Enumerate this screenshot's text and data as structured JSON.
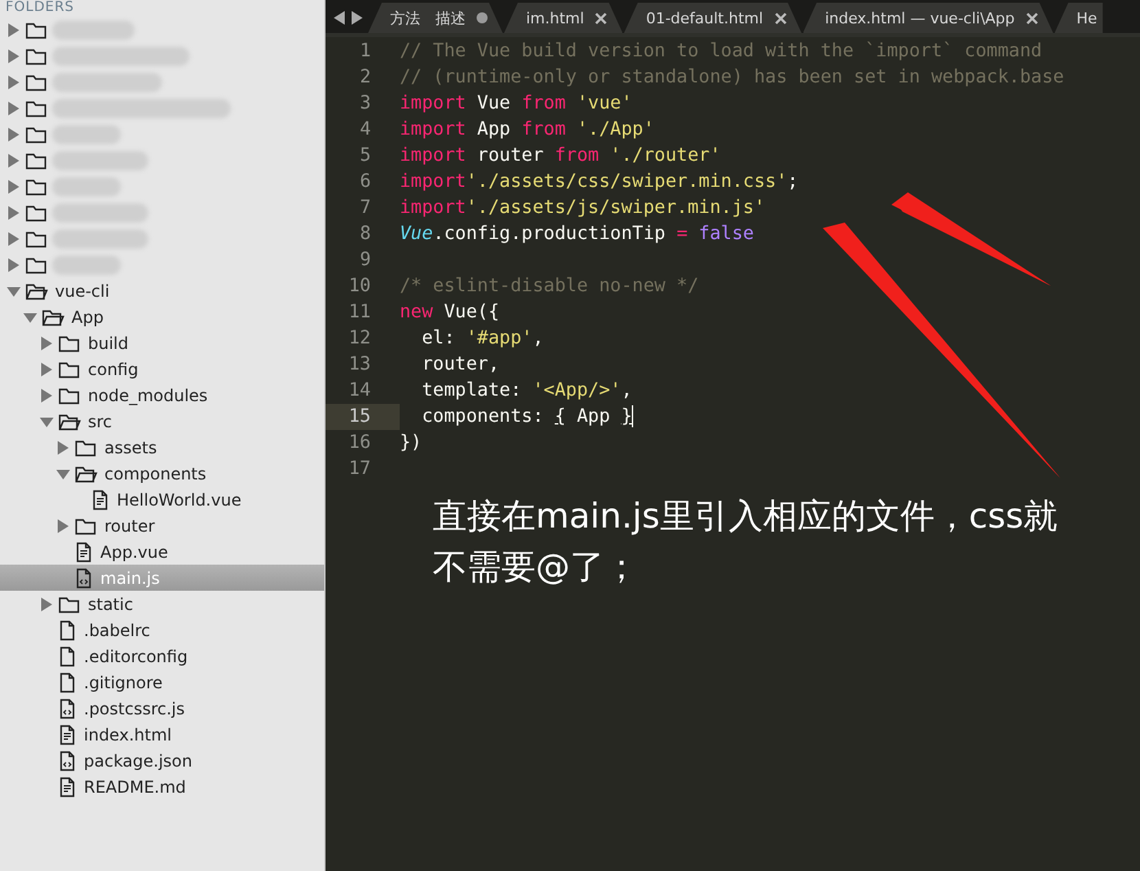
{
  "sidebar": {
    "header": "FOLDERS",
    "items": [
      {
        "kind": "redacted",
        "expanded": false
      },
      {
        "kind": "redacted",
        "expanded": false
      },
      {
        "kind": "redacted",
        "expanded": false
      },
      {
        "kind": "redacted",
        "expanded": false
      },
      {
        "kind": "redacted",
        "expanded": false
      },
      {
        "kind": "redacted",
        "expanded": false
      },
      {
        "kind": "redacted",
        "expanded": false
      },
      {
        "kind": "redacted",
        "expanded": false
      },
      {
        "kind": "redacted",
        "expanded": false
      },
      {
        "kind": "redacted",
        "expanded": false
      },
      {
        "kind": "folder",
        "label": "vue-cli",
        "expanded": true,
        "selected": false,
        "children": [
          {
            "kind": "folder",
            "label": "App",
            "expanded": true,
            "selected": false,
            "children": [
              {
                "kind": "folder",
                "label": "build",
                "expanded": false,
                "selected": false
              },
              {
                "kind": "folder",
                "label": "config",
                "expanded": false,
                "selected": false
              },
              {
                "kind": "folder",
                "label": "node_modules",
                "expanded": false,
                "selected": false
              },
              {
                "kind": "folder",
                "label": "src",
                "expanded": true,
                "selected": false,
                "children": [
                  {
                    "kind": "folder",
                    "label": "assets",
                    "expanded": false,
                    "selected": false
                  },
                  {
                    "kind": "folder",
                    "label": "components",
                    "expanded": true,
                    "selected": false,
                    "children": [
                      {
                        "kind": "text-file",
                        "label": "HelloWorld.vue",
                        "selected": false
                      }
                    ]
                  },
                  {
                    "kind": "folder",
                    "label": "router",
                    "expanded": false,
                    "selected": false
                  },
                  {
                    "kind": "text-file",
                    "label": "App.vue",
                    "selected": false
                  },
                  {
                    "kind": "script-file",
                    "label": "main.js",
                    "selected": true
                  }
                ]
              },
              {
                "kind": "folder",
                "label": "static",
                "expanded": false,
                "selected": false
              },
              {
                "kind": "plain-file",
                "label": ".babelrc",
                "selected": false
              },
              {
                "kind": "plain-file",
                "label": ".editorconfig",
                "selected": false
              },
              {
                "kind": "plain-file",
                "label": ".gitignore",
                "selected": false
              },
              {
                "kind": "script-file",
                "label": ".postcssrc.js",
                "selected": false
              },
              {
                "kind": "text-file",
                "label": "index.html",
                "selected": false
              },
              {
                "kind": "script-file",
                "label": "package.json",
                "selected": false
              },
              {
                "kind": "text-file",
                "label": "README.md",
                "selected": false
              }
            ]
          }
        ]
      }
    ]
  },
  "tabs": [
    {
      "label": "方法　描述",
      "modified": true
    },
    {
      "label": "im.html",
      "modified": false
    },
    {
      "label": "01-default.html",
      "modified": false
    },
    {
      "label": "index.html — vue-cli\\App",
      "modified": false
    },
    {
      "label": "He"
    }
  ],
  "editor": {
    "lines": [
      {
        "number": "1",
        "current": false,
        "tokens": [
          {
            "kind": "comment",
            "text": "// The Vue build version to load with the `import` command"
          }
        ]
      },
      {
        "number": "2",
        "current": false,
        "tokens": [
          {
            "kind": "comment",
            "text": "// (runtime-only or standalone) has been set in webpack.base"
          }
        ]
      },
      {
        "number": "3",
        "current": false,
        "tokens": [
          {
            "kind": "keyword",
            "text": "import"
          },
          {
            "kind": "plain",
            "text": " Vue "
          },
          {
            "kind": "keyword",
            "text": "from"
          },
          {
            "kind": "string",
            "text": " 'vue'"
          }
        ]
      },
      {
        "number": "4",
        "current": false,
        "tokens": [
          {
            "kind": "keyword",
            "text": "import"
          },
          {
            "kind": "plain",
            "text": " App "
          },
          {
            "kind": "keyword",
            "text": "from"
          },
          {
            "kind": "string",
            "text": " './App'"
          }
        ]
      },
      {
        "number": "5",
        "current": false,
        "tokens": [
          {
            "kind": "keyword",
            "text": "import"
          },
          {
            "kind": "plain",
            "text": " router "
          },
          {
            "kind": "keyword",
            "text": "from"
          },
          {
            "kind": "string",
            "text": " './router'"
          }
        ]
      },
      {
        "number": "6",
        "current": false,
        "tokens": [
          {
            "kind": "keyword",
            "text": "import"
          },
          {
            "kind": "string",
            "text": "'./assets/css/swiper.min.css'"
          },
          {
            "kind": "plain",
            "text": ";"
          }
        ]
      },
      {
        "number": "7",
        "current": false,
        "tokens": [
          {
            "kind": "keyword",
            "text": "import"
          },
          {
            "kind": "string",
            "text": "'./assets/js/swiper.min.js'"
          }
        ]
      },
      {
        "number": "8",
        "current": false,
        "tokens": [
          {
            "kind": "type",
            "text": "Vue"
          },
          {
            "kind": "plain",
            "text": ".config.productionTip "
          },
          {
            "kind": "keyword",
            "text": "="
          },
          {
            "kind": "constant",
            "text": " false"
          }
        ]
      },
      {
        "number": "9",
        "current": false
      },
      {
        "number": "10",
        "current": false,
        "tokens": [
          {
            "kind": "comment",
            "text": "/* eslint-disable no-new */"
          }
        ]
      },
      {
        "number": "11",
        "current": false,
        "tokens": [
          {
            "kind": "keyword",
            "text": "new"
          },
          {
            "kind": "plain",
            "text": " Vue({"
          }
        ]
      },
      {
        "number": "12",
        "current": false,
        "tokens": [
          {
            "kind": "plain",
            "text": "  el: "
          },
          {
            "kind": "string",
            "text": "'#app'"
          },
          {
            "kind": "plain",
            "text": ","
          }
        ]
      },
      {
        "number": "13",
        "current": false,
        "tokens": [
          {
            "kind": "plain",
            "text": "  router,"
          }
        ]
      },
      {
        "number": "14",
        "current": false,
        "tokens": [
          {
            "kind": "plain",
            "text": "  template: "
          },
          {
            "kind": "string",
            "text": "'<App/>'"
          },
          {
            "kind": "plain",
            "text": ","
          }
        ]
      },
      {
        "number": "15",
        "current": true,
        "tokens": [
          {
            "kind": "plain",
            "text": "  components: "
          },
          {
            "kind": "match",
            "text": "{"
          },
          {
            "kind": "plain",
            "text": " App "
          },
          {
            "kind": "match",
            "text": "}"
          }
        ]
      },
      {
        "number": "16",
        "current": false,
        "tokens": [
          {
            "kind": "plain",
            "text": "})"
          }
        ]
      },
      {
        "number": "17",
        "current": false
      }
    ]
  },
  "annotation": {
    "text": "直接在main.js里引入相应的文件，css就不需要@了；"
  }
}
